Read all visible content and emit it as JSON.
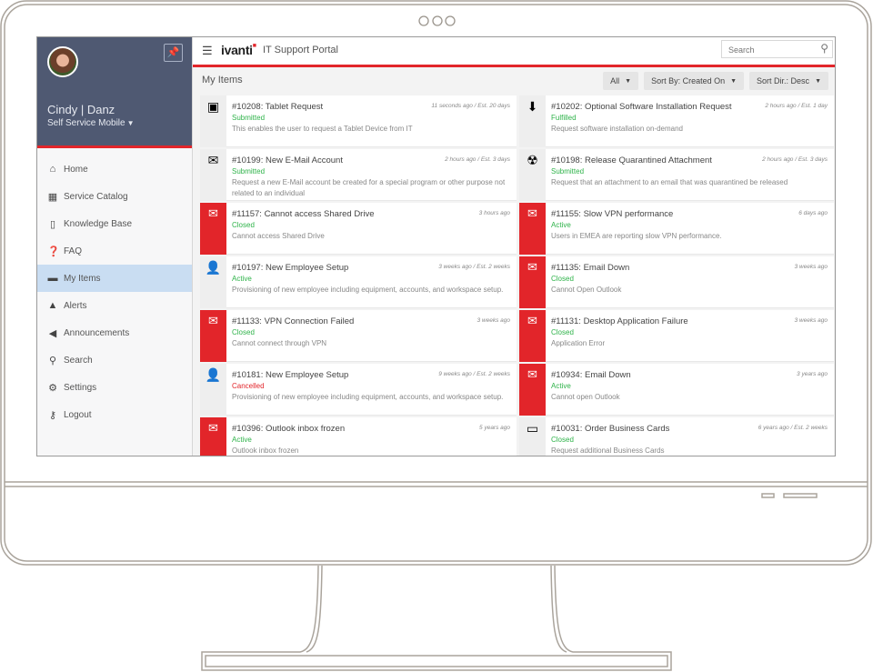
{
  "window": {
    "app_title": "IT Support Portal",
    "brand": "ivanti"
  },
  "user": {
    "name": "Cindy | Danz",
    "role": "Self Service Mobile"
  },
  "icons": {
    "pin": "📌",
    "hamburger": "☰",
    "search": "⚲",
    "caret": "▼",
    "envelope": "✉",
    "tablet": "▣",
    "email-account": "✉",
    "software": "⬇",
    "quarantine": "☢",
    "employee": "👤",
    "business-card": "▭"
  },
  "sidebar": {
    "items": [
      {
        "label": "Home",
        "icon": "⌂",
        "icon_name": "home-icon"
      },
      {
        "label": "Service Catalog",
        "icon": "▦",
        "icon_name": "grid-icon"
      },
      {
        "label": "Knowledge Base",
        "icon": "▯",
        "icon_name": "book-icon"
      },
      {
        "label": "FAQ",
        "icon": "❓",
        "icon_name": "faq-icon"
      },
      {
        "label": "My Items",
        "icon": "▬",
        "icon_name": "folder-icon",
        "active": true
      },
      {
        "label": "Alerts",
        "icon": "▲",
        "icon_name": "bell-icon"
      },
      {
        "label": "Announcements",
        "icon": "◀",
        "icon_name": "megaphone-icon"
      },
      {
        "label": "Search",
        "icon": "⚲",
        "icon_name": "search-icon"
      },
      {
        "label": "Settings",
        "icon": "⚙",
        "icon_name": "gear-icon"
      },
      {
        "label": "Logout",
        "icon": "⚷",
        "icon_name": "key-icon"
      }
    ]
  },
  "header": {
    "search_placeholder": "Search"
  },
  "main": {
    "title": "My Items",
    "filters": [
      {
        "label": "All"
      },
      {
        "label": "Sort By: Created On"
      },
      {
        "label": "Sort Dir.: Desc"
      }
    ],
    "items": [
      {
        "title": "#10208: Tablet Request",
        "meta": "11 seconds ago / Est. 20 days",
        "status": "Submitted",
        "desc": "This enables the user to request a Tablet Device from IT",
        "icon": "tablet",
        "icon_glyph": "▣",
        "red": false
      },
      {
        "title": "#10202: Optional Software Installation Request",
        "meta": "2 hours ago / Est. 1 day",
        "status": "Fulfilled",
        "desc": "Request software installation on-demand",
        "icon": "software",
        "icon_glyph": "⬇",
        "red": false
      },
      {
        "title": "#10199: New E-Mail Account",
        "meta": "2 hours ago / Est. 3 days",
        "status": "Submitted",
        "desc": "Request a new E-Mail account be created for a special program or other purpose not related to an individual",
        "icon": "email-account",
        "icon_glyph": "✉",
        "red": false
      },
      {
        "title": "#10198: Release Quarantined Attachment",
        "meta": "2 hours ago / Est. 3 days",
        "status": "Submitted",
        "desc": "Request that an attachment to an email that was quarantined be released",
        "icon": "quarantine",
        "icon_glyph": "☢",
        "red": false
      },
      {
        "title": "#11157: Cannot access Shared Drive",
        "meta": "3 hours ago",
        "status": "Closed",
        "desc": "Cannot access Shared Drive",
        "icon": "envelope",
        "icon_glyph": "✉",
        "red": true
      },
      {
        "title": "#11155: Slow VPN performance",
        "meta": "6 days ago",
        "status": "Active",
        "desc": "Users in EMEA are reporting slow VPN performance.",
        "icon": "envelope",
        "icon_glyph": "✉",
        "red": true
      },
      {
        "title": "#10197: New Employee Setup",
        "meta": "3 weeks ago / Est. 2 weeks",
        "status": "Active",
        "desc": "Provisioning of new employee including equipment, accounts, and workspace setup.",
        "icon": "employee",
        "icon_glyph": "👤",
        "red": false
      },
      {
        "title": "#11135: Email Down",
        "meta": "3 weeks ago",
        "status": "Closed",
        "desc": "Cannot Open Outlook",
        "icon": "envelope",
        "icon_glyph": "✉",
        "red": true
      },
      {
        "title": "#11133: VPN Connection Failed",
        "meta": "3 weeks ago",
        "status": "Closed",
        "desc": "Cannot connect through VPN",
        "icon": "envelope",
        "icon_glyph": "✉",
        "red": true
      },
      {
        "title": "#11131: Desktop Application Failure",
        "meta": "3 weeks ago",
        "status": "Closed",
        "desc": "Application Error",
        "icon": "envelope",
        "icon_glyph": "✉",
        "red": true
      },
      {
        "title": "#10181: New Employee Setup",
        "meta": "9 weeks ago / Est. 2 weeks",
        "status": "Cancelled",
        "desc": "Provisioning of new employee including equipment, accounts, and workspace setup.",
        "icon": "employee",
        "icon_glyph": "👤",
        "red": false
      },
      {
        "title": "#10934: Email Down",
        "meta": "3 years ago",
        "status": "Active",
        "desc": "Cannot open Outlook",
        "icon": "envelope",
        "icon_glyph": "✉",
        "red": true
      },
      {
        "title": "#10396: Outlook inbox frozen",
        "meta": "5 years ago",
        "status": "Active",
        "desc": "Outlook inbox frozen",
        "icon": "envelope",
        "icon_glyph": "✉",
        "red": true
      },
      {
        "title": "#10031: Order Business Cards",
        "meta": "6 years ago / Est. 2 weeks",
        "status": "Closed",
        "desc": "Request additional Business Cards",
        "icon": "business-card",
        "icon_glyph": "▭",
        "red": false
      }
    ]
  },
  "colors": {
    "accent": "#e2252a",
    "profile_bg": "#4f5972",
    "status_ok": "#2fb34a",
    "status_cancelled": "#e2252a",
    "active_nav": "#c9ddf2"
  }
}
